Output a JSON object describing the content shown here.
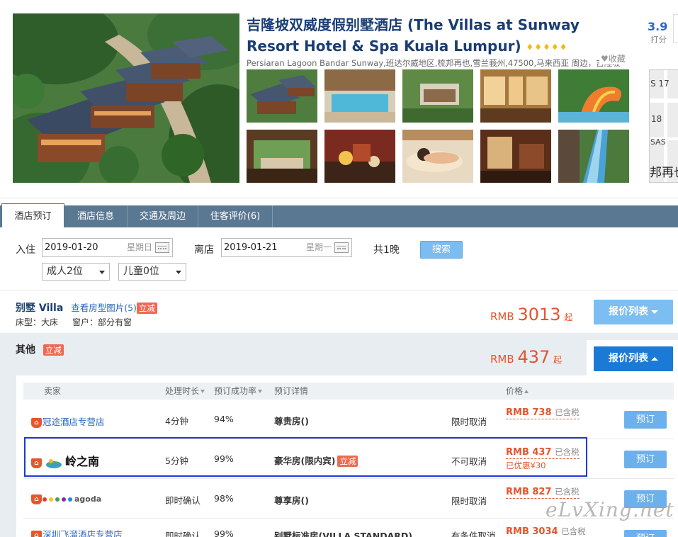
{
  "hotel": {
    "title": "吉隆坡双威度假别墅酒店 (The Villas at Sunway Resort Hotel & Spa Kuala Lumpur)",
    "stars": "♦♦♦♦♦",
    "address": "Persiaran Lagoon Bandar Sunway,班达尔威地区,梳邦再也,雪兰莪州,47500,马来西亚 周边，吉隆坡",
    "favorite_label": "收藏",
    "score": "3.9",
    "score_label": "打分"
  },
  "map": {
    "labels": [
      "S 17",
      "18",
      "SAS",
      "邦再也"
    ]
  },
  "tabs": [
    {
      "label": "酒店预订"
    },
    {
      "label": "酒店信息"
    },
    {
      "label": "交通及周边"
    },
    {
      "label": "住客评价(6)"
    }
  ],
  "search": {
    "checkin_label": "入住",
    "checkin_date": "2019-01-20",
    "checkin_weekday": "星期日",
    "checkout_label": "离店",
    "checkout_date": "2019-01-21",
    "checkout_weekday": "星期一",
    "nights": "共1晚",
    "search_button": "搜索",
    "adults": "成人2位",
    "children": "儿童0位"
  },
  "rooms": [
    {
      "name": "别墅 Villa",
      "photos_link": "查看房型图片(5)",
      "badge": "立减",
      "bed": "床型：大床",
      "window": "窗户：部分有窗",
      "currency": "RMB",
      "price": "3013",
      "suffix": "起",
      "button": "报价列表"
    },
    {
      "name": "其他",
      "badge": "立减",
      "currency": "RMB",
      "price": "437",
      "suffix": "起",
      "button": "报价列表"
    }
  ],
  "table": {
    "headers": [
      "卖家",
      "处理时长",
      "预订成功率",
      "预订详情",
      "价格"
    ],
    "rows": [
      {
        "seller": "冠途酒店专营店",
        "time": "4分钟",
        "rate": "94%",
        "detail": "尊贵房()",
        "badge": "",
        "cancel": "限时取消",
        "price": "RMB 738",
        "tax": "已含税",
        "discount": "",
        "button": "预订"
      },
      {
        "seller": "岭之南",
        "time": "5分钟",
        "rate": "99%",
        "detail": "豪华房(限内宾)",
        "badge": "立减",
        "cancel": "不可取消",
        "price": "RMB 437",
        "tax": "已含税",
        "discount": "已优惠¥30",
        "button": "预订"
      },
      {
        "seller": "agoda",
        "time": "即时确认",
        "rate": "98%",
        "detail": "尊享房()",
        "badge": "",
        "cancel": "限时取消",
        "price": "RMB 827",
        "tax": "已含税",
        "discount": "",
        "button": "预订"
      },
      {
        "seller": "深圳飞溜酒店专营店",
        "time": "即时确认",
        "rate": "99%",
        "detail": "别墅标准房(VILLA STANDARD)",
        "badge": "",
        "cancel": "有条件取消",
        "price": "RMB 3034",
        "tax": "已含税",
        "discount": "",
        "button": "预订"
      }
    ]
  },
  "watermark": "eLvXing.net",
  "colors": {
    "title": "#1a3d73",
    "price": "#e4542d",
    "tabbar": "#5b7892",
    "button": "#6cb0ee",
    "badge": "#ef6951",
    "highlight": "#1a3bd1"
  }
}
